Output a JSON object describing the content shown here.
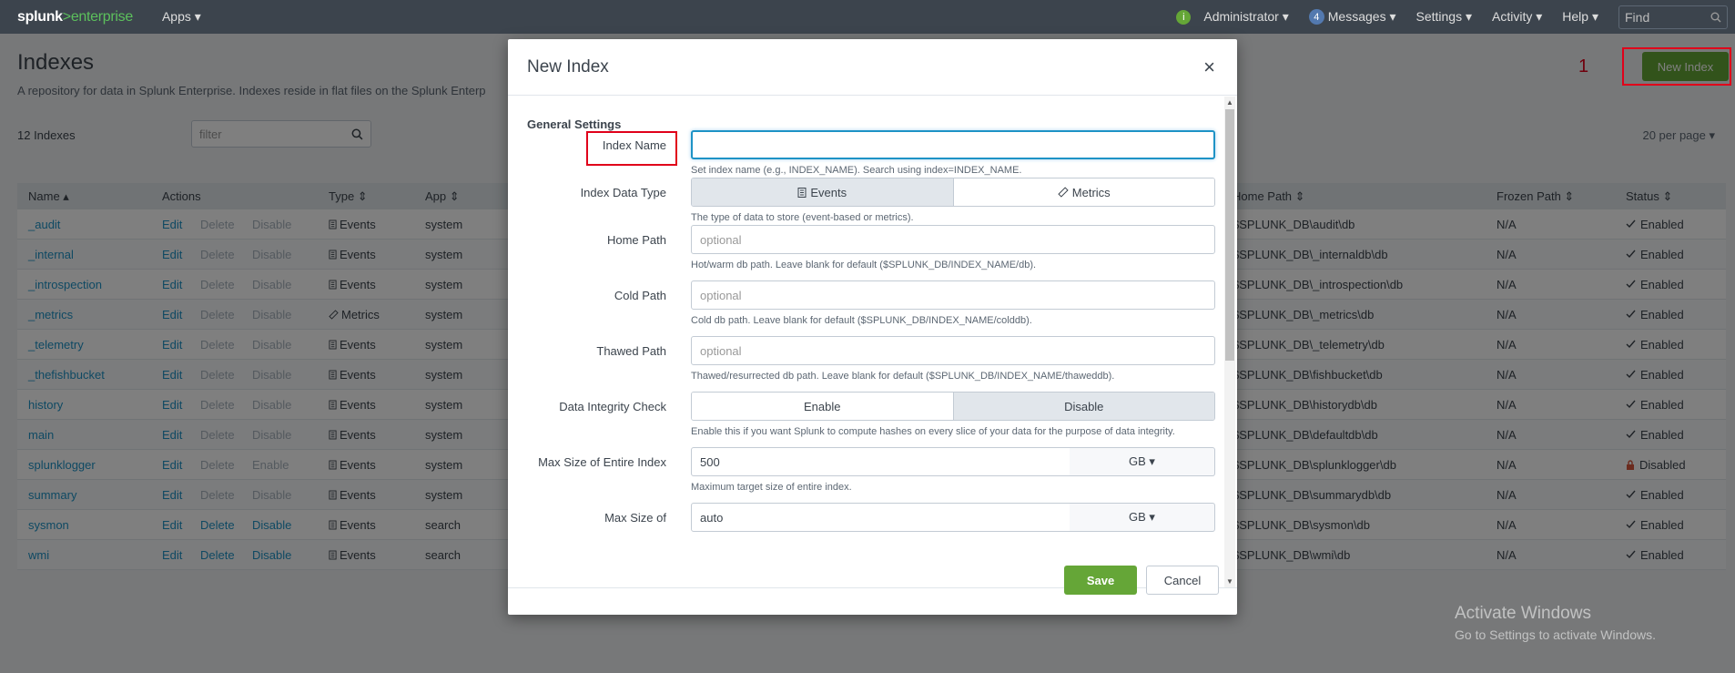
{
  "topbar": {
    "brand_a": "splunk",
    "brand_gt": ">",
    "brand_b": "enterprise",
    "apps": "Apps ▾",
    "user": "Administrator ▾",
    "messages_count": "4",
    "messages": "Messages ▾",
    "settings": "Settings ▾",
    "activity": "Activity ▾",
    "help": "Help ▾",
    "find_placeholder": "Find"
  },
  "page": {
    "title": "Indexes",
    "description": "A repository for data in Splunk Enterprise. Indexes reside in flat files on the Splunk Enterp",
    "count": "12 Indexes",
    "filter_placeholder": "filter",
    "per_page": "20 per page ▾",
    "new_index": "New Index",
    "annotation_number": "1"
  },
  "table": {
    "headers": {
      "name": "Name ▴",
      "actions": "Actions",
      "type": "Type ⇕",
      "app": "App ⇕",
      "home_path": "Home Path ⇕",
      "frozen_path": "Frozen Path ⇕",
      "status": "Status ⇕"
    },
    "rows": [
      {
        "name": "_audit",
        "edit": "Edit",
        "del": "Delete",
        "dis": "Disable",
        "type": "Events",
        "app": "system",
        "home": "$SPLUNK_DB\\audit\\db",
        "frozen": "N/A",
        "status": "Enabled"
      },
      {
        "name": "_internal",
        "edit": "Edit",
        "del": "Delete",
        "dis": "Disable",
        "type": "Events",
        "app": "system",
        "home": "$SPLUNK_DB\\_internaldb\\db",
        "frozen": "N/A",
        "status": "Enabled"
      },
      {
        "name": "_introspection",
        "edit": "Edit",
        "del": "Delete",
        "dis": "Disable",
        "type": "Events",
        "app": "system",
        "home": "$SPLUNK_DB\\_introspection\\db",
        "frozen": "N/A",
        "status": "Enabled"
      },
      {
        "name": "_metrics",
        "edit": "Edit",
        "del": "Delete",
        "dis": "Disable",
        "type": "Metrics",
        "app": "system",
        "home": "$SPLUNK_DB\\_metrics\\db",
        "frozen": "N/A",
        "status": "Enabled"
      },
      {
        "name": "_telemetry",
        "edit": "Edit",
        "del": "Delete",
        "dis": "Disable",
        "type": "Events",
        "app": "system",
        "home": "$SPLUNK_DB\\_telemetry\\db",
        "frozen": "N/A",
        "status": "Enabled"
      },
      {
        "name": "_thefishbucket",
        "edit": "Edit",
        "del": "Delete",
        "dis": "Disable",
        "type": "Events",
        "app": "system",
        "home": "$SPLUNK_DB\\fishbucket\\db",
        "frozen": "N/A",
        "status": "Enabled"
      },
      {
        "name": "history",
        "edit": "Edit",
        "del": "Delete",
        "dis": "Disable",
        "type": "Events",
        "app": "system",
        "home": "$SPLUNK_DB\\historydb\\db",
        "frozen": "N/A",
        "status": "Enabled"
      },
      {
        "name": "main",
        "edit": "Edit",
        "del": "Delete",
        "dis": "Disable",
        "type": "Events",
        "app": "system",
        "home": "$SPLUNK_DB\\defaultdb\\db",
        "frozen": "N/A",
        "status": "Enabled"
      },
      {
        "name": "splunklogger",
        "edit": "Edit",
        "del": "Delete",
        "dis": "Enable",
        "type": "Events",
        "app": "system",
        "home": "$SPLUNK_DB\\splunklogger\\db",
        "frozen": "N/A",
        "status": "Disabled"
      },
      {
        "name": "summary",
        "edit": "Edit",
        "del": "Delete",
        "dis": "Disable",
        "type": "Events",
        "app": "system",
        "home": "$SPLUNK_DB\\summarydb\\db",
        "frozen": "N/A",
        "status": "Enabled"
      },
      {
        "name": "sysmon",
        "edit": "Edit",
        "del": "Delete",
        "dis": "Disable",
        "type": "Events",
        "app": "search",
        "home": "$SPLUNK_DB\\sysmon\\db",
        "frozen": "N/A",
        "status": "Enabled"
      },
      {
        "name": "wmi",
        "edit": "Edit",
        "del": "Delete",
        "dis": "Disable",
        "type": "Events",
        "app": "search",
        "home": "$SPLUNK_DB\\wmi\\db",
        "frozen": "N/A",
        "status": "Enabled"
      }
    ]
  },
  "modal": {
    "title": "New Index",
    "close": "×",
    "section": "General Settings",
    "index_name": {
      "label": "Index Name",
      "value": "",
      "help": "Set index name (e.g., INDEX_NAME). Search using index=INDEX_NAME."
    },
    "data_type": {
      "label": "Index Data Type",
      "opt_events": "Events",
      "opt_metrics": "Metrics",
      "help": "The type of data to store (event-based or metrics)."
    },
    "home_path": {
      "label": "Home Path",
      "placeholder": "optional",
      "help": "Hot/warm db path. Leave blank for default ($SPLUNK_DB/INDEX_NAME/db)."
    },
    "cold_path": {
      "label": "Cold Path",
      "placeholder": "optional",
      "help": "Cold db path. Leave blank for default ($SPLUNK_DB/INDEX_NAME/colddb)."
    },
    "thawed_path": {
      "label": "Thawed Path",
      "placeholder": "optional",
      "help": "Thawed/resurrected db path. Leave blank for default ($SPLUNK_DB/INDEX_NAME/thaweddb)."
    },
    "integrity": {
      "label": "Data Integrity Check",
      "opt_enable": "Enable",
      "opt_disable": "Disable",
      "help": "Enable this if you want Splunk to compute hashes on every slice of your data for the purpose of data integrity."
    },
    "max_size": {
      "label": "Max Size of Entire Index",
      "value": "500",
      "unit": "GB ▾",
      "help": "Maximum target size of entire index."
    },
    "max_bucket": {
      "label": "Max Size of",
      "value": "auto",
      "unit": "GB ▾"
    },
    "save": "Save",
    "cancel": "Cancel"
  },
  "watermark": {
    "line1": "Activate Windows",
    "line2": "Go to Settings to activate Windows."
  }
}
